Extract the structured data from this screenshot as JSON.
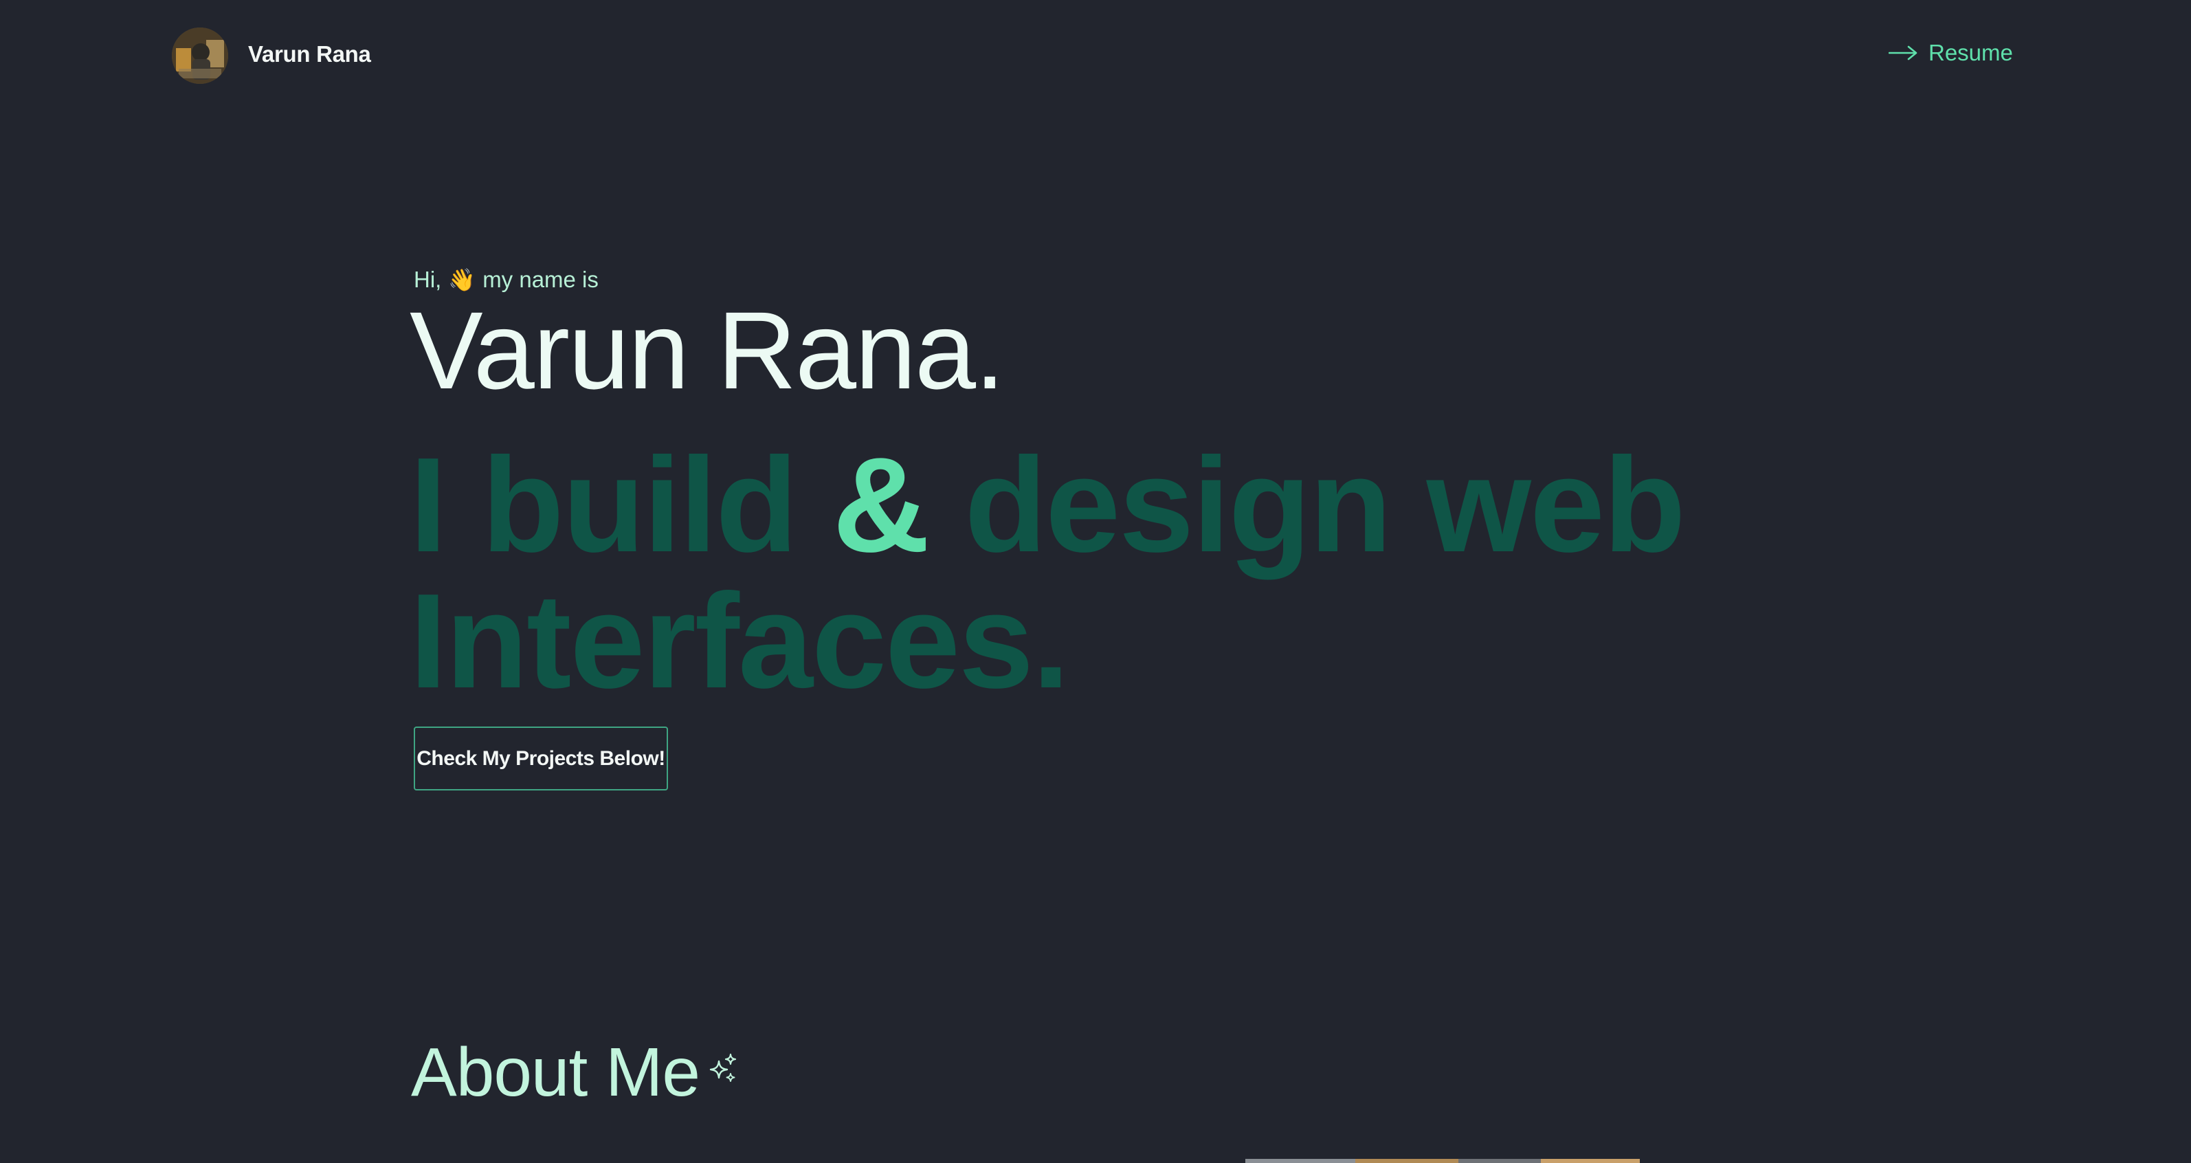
{
  "header": {
    "avatar_icon": "profile-avatar",
    "brand_name": "Varun Rana",
    "resume_label": "Resume",
    "resume_icon": "arrow-right-icon"
  },
  "hero": {
    "greeting_prefix": "Hi,",
    "greeting_emoji": "👋",
    "greeting_suffix": "my name is",
    "name": "Varun Rana.",
    "tagline_part1": "I build",
    "tagline_amp": "&",
    "tagline_part2": "design web Interfaces.",
    "cta_label": "Check My Projects Below!"
  },
  "about": {
    "title": "About Me",
    "title_icon": "sparkles-icon"
  },
  "colors": {
    "background": "#22252e",
    "accent": "#5fe0ab",
    "accent_dark": "#0f5547",
    "text_light": "#ecfaf4",
    "text_mint": "#c2f4dd",
    "button_border": "#3fa583"
  }
}
